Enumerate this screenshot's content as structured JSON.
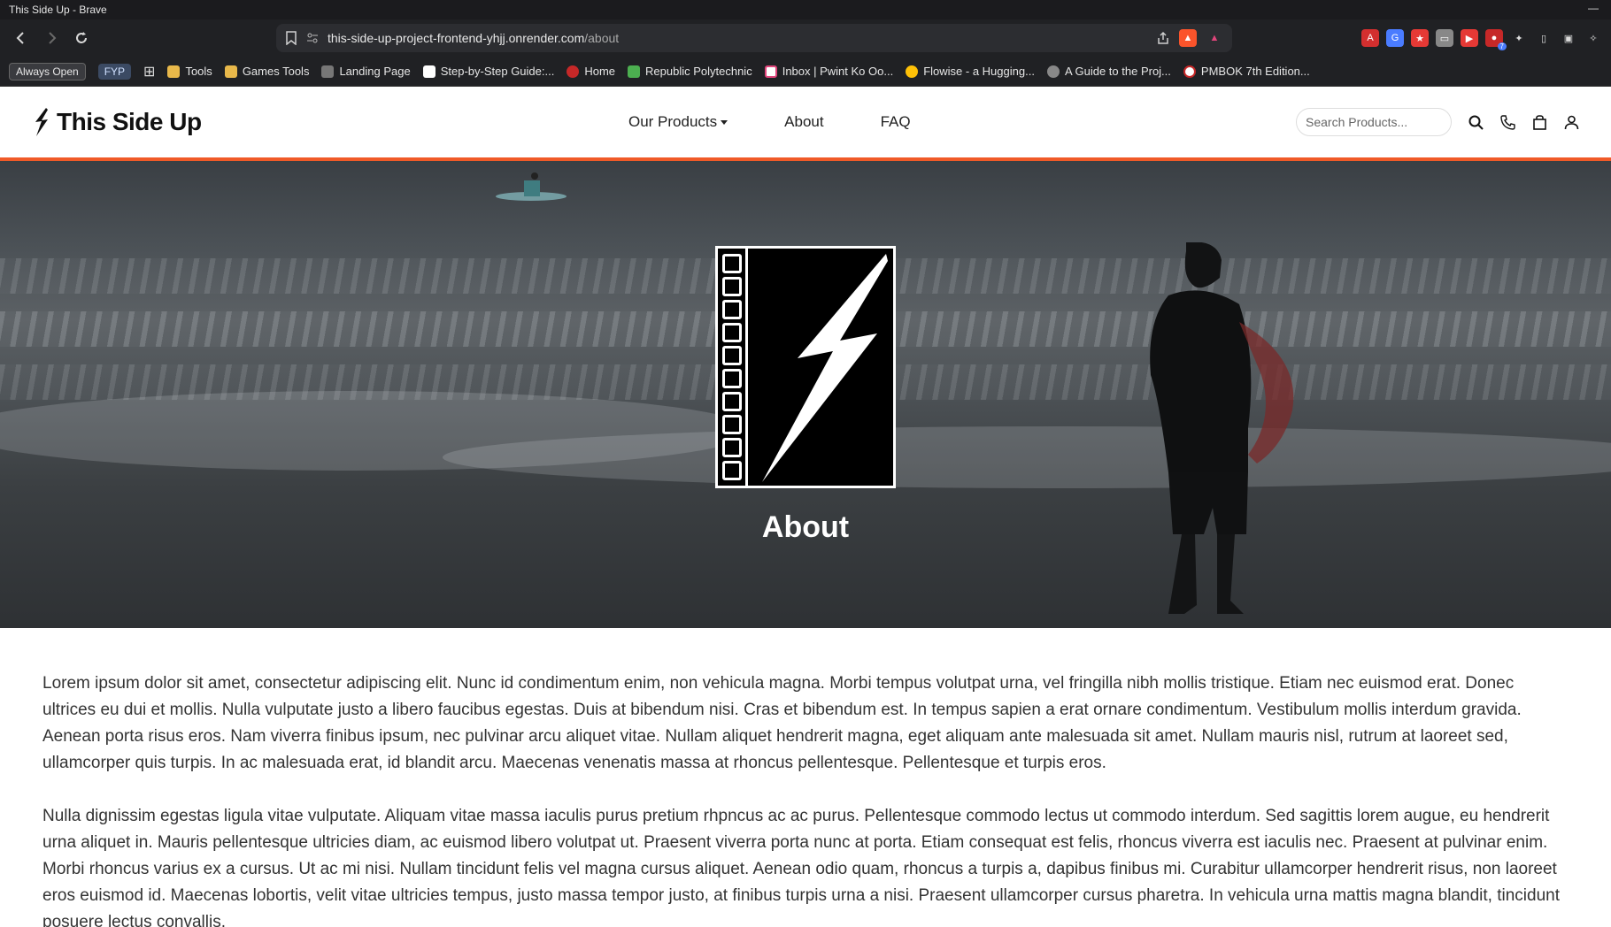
{
  "browser": {
    "window_title": "This Side Up - Brave",
    "url_host": "this-side-up-project-frontend-yhjj.onrender.com",
    "url_path": "/about",
    "extension_badge": "7",
    "bookmarks": [
      {
        "label": "Always Open",
        "kind": "pill-dark"
      },
      {
        "label": "FYP",
        "kind": "pill"
      },
      {
        "label": "Tools",
        "icon": "folder-icon"
      },
      {
        "label": "Games Tools",
        "icon": "folder-icon"
      },
      {
        "label": "Landing Page",
        "icon": "page-icon"
      },
      {
        "label": "Step-by-Step Guide:...",
        "icon": "medium-icon"
      },
      {
        "label": "Home",
        "icon": "opera-icon"
      },
      {
        "label": "Republic Polytechnic",
        "icon": "rp-icon"
      },
      {
        "label": "Inbox | Pwint Ko Oo...",
        "icon": "mail-icon"
      },
      {
        "label": "Flowise - a Hugging...",
        "icon": "hf-icon"
      },
      {
        "label": "A Guide to the Proj...",
        "icon": "globe-icon"
      },
      {
        "label": "PMBOK 7th Edition...",
        "icon": "book-icon"
      }
    ]
  },
  "site": {
    "brand": "This Side Up",
    "nav": {
      "products": "Our Products",
      "about": "About",
      "faq": "FAQ"
    },
    "search_placeholder": "Search Products..."
  },
  "hero": {
    "title": "About"
  },
  "content": {
    "paragraphs": [
      "Lorem ipsum dolor sit amet, consectetur adipiscing elit. Nunc id condimentum enim, non vehicula magna. Morbi tempus volutpat urna, vel fringilla nibh mollis tristique. Etiam nec euismod erat. Donec ultrices eu dui et mollis. Nulla vulputate justo a libero faucibus egestas. Duis at bibendum nisi. Cras et bibendum est. In tempus sapien a erat ornare condimentum. Vestibulum mollis interdum gravida. Aenean porta risus eros. Nam viverra finibus ipsum, nec pulvinar arcu aliquet vitae. Nullam aliquet hendrerit magna, eget aliquam ante malesuada sit amet. Nullam mauris nisl, rutrum at laoreet sed, ullamcorper quis turpis. In ac malesuada erat, id blandit arcu. Maecenas venenatis massa at rhoncus pellentesque. Pellentesque et turpis eros.",
      "Nulla dignissim egestas ligula vitae vulputate. Aliquam vitae massa iaculis purus pretium rhpncus ac ac purus. Pellentesque commodo lectus ut commodo interdum. Sed sagittis lorem augue, eu hendrerit urna aliquet in. Mauris pellentesque ultricies diam, ac euismod libero volutpat ut. Praesent viverra porta nunc at porta. Etiam consequat est felis, rhoncus viverra est iaculis nec. Praesent at pulvinar enim. Morbi rhoncus varius ex a cursus. Ut ac mi nisi. Nullam tincidunt felis vel magna cursus aliquet. Aenean odio quam, rhoncus a turpis a, dapibus finibus mi. Curabitur ullamcorper hendrerit risus, non laoreet eros euismod id. Maecenas lobortis, velit vitae ultricies tempus, justo massa tempor justo, at finibus turpis urna a nisi. Praesent ullamcorper cursus pharetra. In vehicula urna mattis magna blandit, tincidunt posuere lectus convallis."
    ]
  },
  "colors": {
    "accent": "#f05a28",
    "browser_bg": "#202124",
    "text": "#333333"
  }
}
